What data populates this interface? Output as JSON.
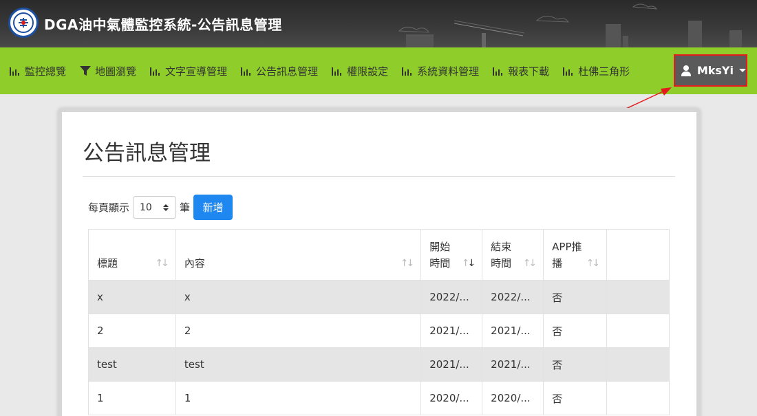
{
  "header": {
    "title": "DGA油中氣體監控系統-公告訊息管理"
  },
  "nav": {
    "items": [
      {
        "label": "監控總覽",
        "icon": "bar-chart-icon"
      },
      {
        "label": "地圖瀏覽",
        "icon": "filter-icon"
      },
      {
        "label": "文字宣導管理",
        "icon": "bar-chart-icon"
      },
      {
        "label": "公告訊息管理",
        "icon": "bar-chart-icon"
      },
      {
        "label": "權限設定",
        "icon": "bar-chart-icon"
      },
      {
        "label": "系統資料管理",
        "icon": "bar-chart-icon"
      },
      {
        "label": "報表下載",
        "icon": "bar-chart-icon"
      },
      {
        "label": "杜佛三角形",
        "icon": "bar-chart-icon"
      }
    ],
    "user": "MksYi"
  },
  "page": {
    "title": "公告訊息管理",
    "per_page_label": "每頁顯示",
    "per_page_value": "10",
    "unit_label": "筆",
    "add_label": "新增"
  },
  "table": {
    "headers": [
      {
        "label": "標題",
        "sort": "none"
      },
      {
        "label": "內容",
        "sort": "none"
      },
      {
        "label": "開始時間",
        "sort": "desc"
      },
      {
        "label": "結束時間",
        "sort": "none"
      },
      {
        "label": "APP推播",
        "sort": "none"
      },
      {
        "label": "",
        "sort": ""
      }
    ],
    "rows": [
      [
        "x",
        "x",
        "2022/...",
        "2022/...",
        "否",
        ""
      ],
      [
        "2",
        "2",
        "2021/...",
        "2021/...",
        "否",
        ""
      ],
      [
        "test",
        "test",
        "2021/...",
        "2021/...",
        "否",
        ""
      ],
      [
        "1",
        "1",
        "2020/...",
        "2020/...",
        "否",
        ""
      ]
    ]
  },
  "colors": {
    "nav_bg": "#8fce2a",
    "accent": "#1e88f0",
    "highlight": "#e31b1b"
  }
}
